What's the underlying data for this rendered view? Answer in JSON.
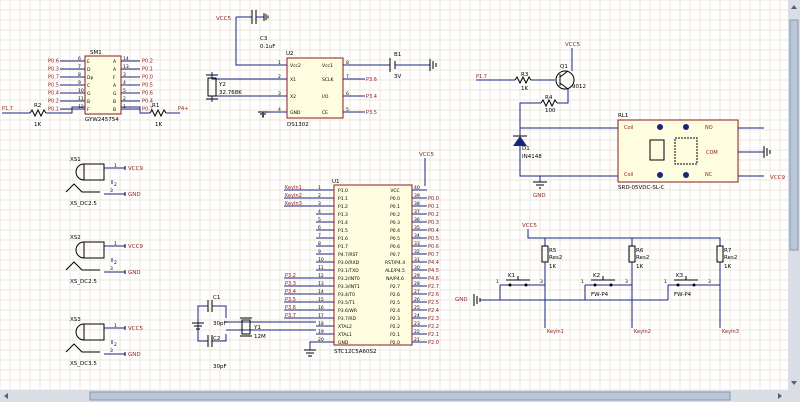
{
  "components": {
    "sm1": {
      "ref": "SM1",
      "name": "GYW245754",
      "left_pins": [
        "P0.6",
        "P0.3",
        "P0.7",
        "P0.5",
        "P0.4",
        "P0.2",
        "P0.1"
      ],
      "right_pins": [
        "P0.2",
        "P0.1",
        "P0.0",
        "P0.5",
        "P0.6",
        "P0.4",
        "P0.7"
      ],
      "left_letters": [
        "E",
        "D",
        "Dp",
        "C",
        "G",
        "B",
        "F"
      ],
      "right_letters": [
        "A",
        "A",
        "F",
        "A",
        "G",
        "B",
        "B"
      ],
      "left_nums": [
        "6",
        "7",
        "8",
        "9",
        "10",
        "11",
        "12"
      ],
      "right_nums": [
        "14",
        "13",
        "3",
        "4",
        "5",
        "2",
        "1"
      ]
    },
    "r2": {
      "ref": "R2",
      "value": "1K",
      "net": "P1.7"
    },
    "r1": {
      "ref": "R1",
      "value": "1K",
      "net": "P4+"
    },
    "c3": {
      "ref": "C3",
      "value": "0.1uF",
      "net": "VCC5"
    },
    "u2": {
      "ref": "U2",
      "name": "DS1302",
      "pins_left": [
        "Vcc2",
        "X1",
        "X2",
        "GND"
      ],
      "pins_right": [
        "Vcc1",
        "SCLK",
        "I/O",
        "CE"
      ],
      "nums_left": [
        "1",
        "2",
        "3",
        "4"
      ],
      "nums_right": [
        "8",
        "7",
        "6",
        "5"
      ],
      "nets_right": [
        "P3.6",
        "P3.4",
        "P3.5"
      ]
    },
    "y2": {
      "ref": "Y2",
      "value": "32.768K"
    },
    "b1": {
      "ref": "B1",
      "value": "3V"
    },
    "q1": {
      "ref": "Q1",
      "name": "9012",
      "net_in": "P1.7",
      "vcc": "VCC5"
    },
    "r3": {
      "ref": "R3",
      "value": "1K"
    },
    "r4": {
      "ref": "R4",
      "value": "100"
    },
    "d1": {
      "ref": "D1",
      "name": "IN4148"
    },
    "rl1": {
      "ref": "RL1",
      "name": "SRD-05VDC-SL-C",
      "coil": "Coil",
      "com": "COM",
      "no": "NO",
      "nc": "NC",
      "pins": [
        "2",
        "3",
        "4",
        "5",
        "1"
      ]
    },
    "xs1": {
      "ref": "XS1",
      "name": "XS_DC2.5"
    },
    "xs2": {
      "ref": "XS2",
      "name": "XS_DC2.5"
    },
    "xs3": {
      "ref": "XS3",
      "name": "XS_DC3.5"
    },
    "u1": {
      "ref": "U1",
      "name": "STC12C5A60S2",
      "left_pins": [
        "P1.0",
        "P1.1",
        "P1.2",
        "P1.3",
        "P1.4",
        "P1.5",
        "P1.6",
        "P1.7",
        "P4.7/RST",
        "P3.0/RXD",
        "P3.1/TXD",
        "P3.2/INT0",
        "P3.3/INT1",
        "P3.4/T0",
        "P3.5/T1",
        "P3.6/WR",
        "P3.7/RD",
        "XTAL2",
        "XTAL1",
        "GND"
      ],
      "right_pins": [
        "VCC",
        "P0.0",
        "P0.1",
        "P0.2",
        "P0.3",
        "P0.4",
        "P0.5",
        "P0.6",
        "P0.7",
        "RST/P4.4",
        "ALE/P4.5",
        "NA/P4.6",
        "P2.7",
        "P2.6",
        "P2.5",
        "P2.4",
        "P2.3",
        "P2.2",
        "P2.1",
        "P2.0"
      ],
      "left_nums": [
        "1",
        "2",
        "3",
        "4",
        "5",
        "6",
        "7",
        "8",
        "9",
        "10",
        "11",
        "12",
        "13",
        "14",
        "15",
        "16",
        "17",
        "18",
        "19",
        "20"
      ],
      "right_nums": [
        "40",
        "39",
        "38",
        "37",
        "36",
        "35",
        "34",
        "33",
        "32",
        "31",
        "30",
        "29",
        "28",
        "27",
        "26",
        "25",
        "24",
        "23",
        "22",
        "21"
      ],
      "left_nets": [
        "KeyIn1",
        "KeyIn2",
        "KeyIn3",
        "",
        "",
        "",
        "",
        "",
        "",
        "",
        "",
        "P3.2",
        "P3.3",
        "P3.4",
        "P3.5",
        "P3.6",
        "P3.7",
        "",
        "",
        ""
      ],
      "right_nets": [
        "",
        "P0.0",
        "P0.1",
        "P0.2",
        "P0.3",
        "P0.4",
        "P0.5",
        "P0.6",
        "P0.7",
        "P4.4",
        "P4.5",
        "P4.6",
        "P2.7",
        "P2.6",
        "P2.5",
        "P2.4",
        "P2.3",
        "P2.2",
        "P2.1",
        "P2.0"
      ]
    },
    "c1": {
      "ref": "C1",
      "value": "30pF"
    },
    "c2": {
      "ref": "C2",
      "value": "30pF"
    },
    "y1": {
      "ref": "Y1",
      "value": "12M"
    },
    "keys": [
      {
        "ref": "K1",
        "label": ""
      },
      {
        "ref": "K2",
        "label": "FW-P4"
      },
      {
        "ref": "K3",
        "label": "FW-P4"
      }
    ],
    "key_rs": [
      {
        "ref": "R5",
        "value": "1K",
        "role": "Res2"
      },
      {
        "ref": "R6",
        "value": "1K",
        "role": "Res2"
      },
      {
        "ref": "R7",
        "value": "1K",
        "role": "Res2"
      }
    ],
    "key_nets": [
      "KeyIn1",
      "KeyIn2",
      "KeyIn3"
    ]
  },
  "power": {
    "vcc5": "VCC5",
    "vcc9": "VCC9",
    "gnd": "GND"
  },
  "colors": {
    "wire": "#1a237e",
    "body_fill": "#fffde0",
    "body_stroke": "#8b1a1a",
    "grid": "#eee6da"
  }
}
